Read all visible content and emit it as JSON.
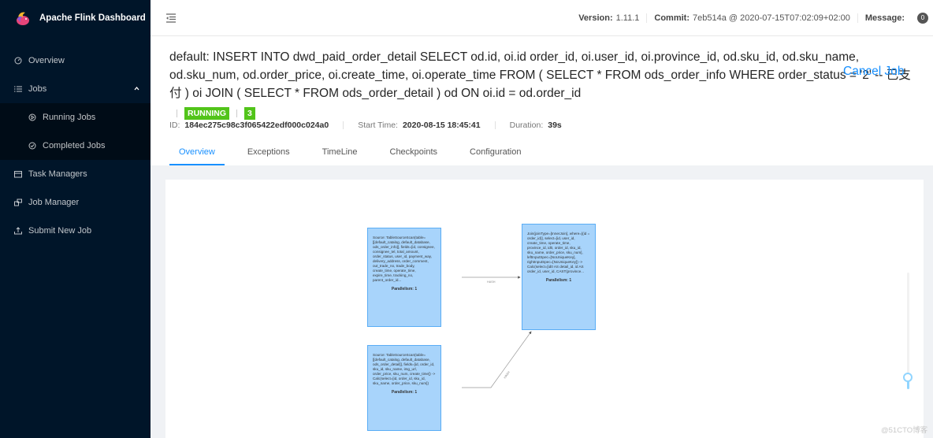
{
  "app": {
    "title": "Apache Flink Dashboard"
  },
  "sidebar": {
    "items": [
      {
        "label": "Overview",
        "icon": "dashboard-icon"
      },
      {
        "label": "Jobs",
        "icon": "list-icon",
        "expanded": true,
        "children": [
          {
            "label": "Running Jobs",
            "icon": "play-circle-icon"
          },
          {
            "label": "Completed Jobs",
            "icon": "check-circle-icon"
          }
        ]
      },
      {
        "label": "Task Managers",
        "icon": "schedule-icon"
      },
      {
        "label": "Job Manager",
        "icon": "build-icon"
      },
      {
        "label": "Submit New Job",
        "icon": "upload-icon"
      }
    ]
  },
  "header": {
    "version_label": "Version:",
    "version": "1.11.1",
    "commit_label": "Commit:",
    "commit": "7eb514a @ 2020-07-15T07:02:09+02:00",
    "message_label": "Message:",
    "message_count": "0"
  },
  "job": {
    "title": "default: INSERT INTO dwd_paid_order_detail SELECT od.id, oi.id order_id, oi.user_id, oi.province_id, od.sku_id, od.sku_name, od.sku_num, od.order_price, oi.create_time, oi.operate_time FROM ( SELECT * FROM ods_order_info WHERE order_status = '2' -- 已支付 ) oi JOIN ( SELECT * FROM ods_order_detail ) od ON oi.id = od.order_id",
    "cancel_label": "Cancel Job",
    "status": "RUNNING",
    "status_color": "#52c41a",
    "running_tasks": "3",
    "id_label": "ID:",
    "id": "184ec275c98c3f065422edf000c024a0",
    "start_time_label": "Start Time:",
    "start_time": "2020-08-15 18:45:41",
    "duration_label": "Duration:",
    "duration": "39s"
  },
  "tabs": [
    {
      "label": "Overview",
      "active": true
    },
    {
      "label": "Exceptions",
      "active": false
    },
    {
      "label": "TimeLine",
      "active": false
    },
    {
      "label": "Checkpoints",
      "active": false
    },
    {
      "label": "Configuration",
      "active": false
    }
  ],
  "graph": {
    "nodes": [
      {
        "text": "Source: TableSourceScan(table=[[default_catalog, default_database, ods_order_info]], fields=[id, consignee, consignee_tel, total_amount, order_status, user_id, payment_way, delivery_address, order_comment, out_trade_no, trade_body, create_time, operate_time, expire_time, tracking_no, parent_order_id...",
        "parallelism": "Parallelism: 1"
      },
      {
        "text": "Source: TableSourceScan(table=[[default_catalog, default_database, ods_order_detail]], fields=[id, order_id, sku_id, sku_name, img_url, order_price, sku_num, create_time]) -> Calc(select=[id, order_id, sku_id, sku_name, order_price, sku_num])",
        "parallelism": "Parallelism: 1"
      },
      {
        "text": "Join(joinType=[InnerJoin], where=[(id = order_id)], select=[id, user_id, create_time, operate_time, province_id, id0, order_id, sku_id, sku_name, order_price, sku_num], leftInputSpec=[NoUniqueKey], rightInputSpec=[NoUniqueKey]) -> Calc(select=[id0 AS detail_id, id AS order_id, user_id, CAST(province...",
        "parallelism": "Parallelism: 1"
      }
    ],
    "edges": [
      {
        "label": "HASH"
      },
      {
        "label": "HASH"
      }
    ],
    "zoom_level": 0.1
  },
  "watermark": "@51CTO博客"
}
